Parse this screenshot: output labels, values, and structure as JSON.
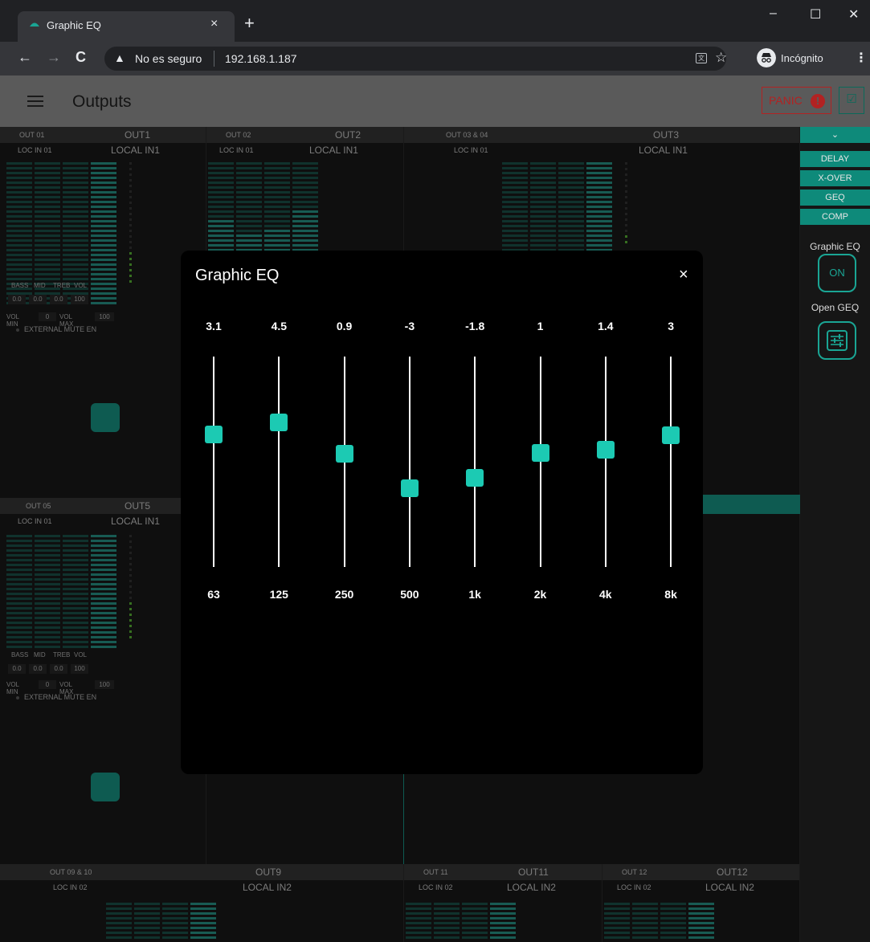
{
  "browser": {
    "tab_title": "Graphic EQ",
    "tab_close": "×",
    "new_tab": "+",
    "minimize": "–",
    "maximize": "☐",
    "close": "✕",
    "back": "←",
    "forward": "→",
    "reload": "C",
    "security_icon": "▲",
    "security_text": "No es seguro",
    "url": "192.168.1.187",
    "star": "☆",
    "incognito_label": "Incógnito",
    "menu": "⋮"
  },
  "header": {
    "title": "Outputs",
    "panic_label": "PANIC",
    "panic_icon": "!",
    "check_icon": "☑"
  },
  "strips": [
    {
      "code": "OUT 01",
      "name": "OUT1",
      "src_code": "LOC IN 01",
      "src_name": "LOCAL IN1"
    },
    {
      "code": "OUT 02",
      "name": "OUT2",
      "src_code": "LOC IN 01",
      "src_name": "LOCAL IN1"
    },
    {
      "code": "OUT 03 & 04",
      "name": "OUT3",
      "src_code": "LOC IN 01",
      "src_name": "LOCAL IN1"
    },
    {
      "code": "OUT 05",
      "name": "OUT5",
      "src_code": "LOC IN 01",
      "src_name": "LOCAL IN1"
    },
    {
      "code": "OUT 09 & 10",
      "name": "OUT9",
      "src_code": "LOC IN 02",
      "src_name": "LOCAL IN2"
    },
    {
      "code": "OUT 11",
      "name": "OUT11",
      "src_code": "LOC IN 02",
      "src_name": "LOCAL IN2"
    },
    {
      "code": "OUT 12",
      "name": "OUT12",
      "src_code": "LOC IN 02",
      "src_name": "LOCAL IN2"
    }
  ],
  "controls": {
    "bass_label": "BASS",
    "mid_label": "MID",
    "treb_label": "TREB",
    "vol_label": "VOL",
    "bass": "0.0",
    "mid": "0.0",
    "treb": "0.0",
    "vol": "100",
    "vol_min_label": "VOL MIN",
    "vol_min": "0",
    "vol_max_label": "VOL MAX",
    "vol_max": "100",
    "ext_mute": "EXTERNAL MUTE EN"
  },
  "side_panel": {
    "chevron": "⌄",
    "buttons": [
      "DELAY",
      "X-OVER",
      "GEQ",
      "COMP"
    ],
    "geq_label": "Graphic EQ",
    "geq_state": "ON",
    "open_geq_label": "Open GEQ"
  },
  "modal": {
    "title": "Graphic EQ",
    "close": "×",
    "range_db": [
      -12,
      12
    ],
    "bands": [
      {
        "freq": "63",
        "value": "3.1"
      },
      {
        "freq": "125",
        "value": "4.5"
      },
      {
        "freq": "250",
        "value": "0.9"
      },
      {
        "freq": "500",
        "value": "-3"
      },
      {
        "freq": "1k",
        "value": "-1.8"
      },
      {
        "freq": "2k",
        "value": "1"
      },
      {
        "freq": "4k",
        "value": "1.4"
      },
      {
        "freq": "8k",
        "value": "3"
      }
    ]
  },
  "colors": {
    "accent": "#1ccab3",
    "panic": "#b22222",
    "header_bg": "#5a5a5a"
  }
}
